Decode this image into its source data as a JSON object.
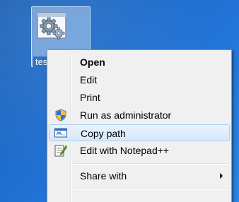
{
  "desktop": {
    "icon": {
      "icon_name": "gear-file-icon",
      "label": "test.bat"
    }
  },
  "context_menu": {
    "items": [
      {
        "label": "Open",
        "bold": true,
        "icon": null,
        "highlighted": false
      },
      {
        "label": "Edit",
        "bold": false,
        "icon": null,
        "highlighted": false
      },
      {
        "label": "Print",
        "bold": false,
        "icon": null,
        "highlighted": false
      },
      {
        "label": "Run as administrator",
        "bold": false,
        "icon": "uac-shield-icon",
        "highlighted": false
      },
      {
        "label": "Copy path",
        "bold": false,
        "icon": "path-window-icon",
        "highlighted": true
      },
      {
        "label": "Edit with Notepad++",
        "bold": false,
        "icon": "notepad-plus-plus-icon",
        "highlighted": false
      },
      {
        "label": "Share with",
        "bold": false,
        "icon": null,
        "highlighted": false,
        "has_submenu": true
      }
    ]
  },
  "colors": {
    "desktop_background": "#1f6fd1",
    "menu_background": "#f0f0f0",
    "highlight_border": "#a8cdf3",
    "highlight_fill": "#d6e8fb"
  }
}
